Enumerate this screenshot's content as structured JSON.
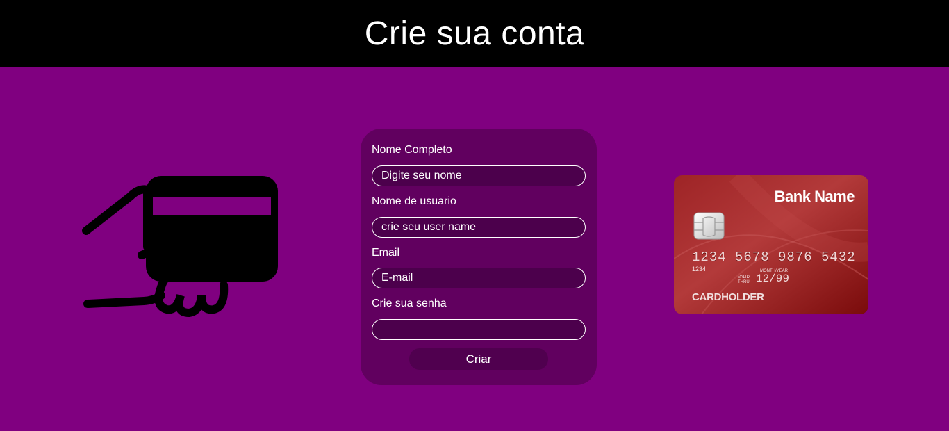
{
  "header": {
    "title": "Crie sua conta"
  },
  "form": {
    "full_name": {
      "label": "Nome Completo",
      "placeholder": "Digite seu nome"
    },
    "username": {
      "label": "Nome de usuario",
      "placeholder": "crie seu user name"
    },
    "email": {
      "label": "Email",
      "placeholder": "E-mail"
    },
    "password": {
      "label": "Crie sua senha",
      "placeholder": ""
    },
    "submit_label": "Criar"
  },
  "card_image": {
    "bank_name": "Bank Name",
    "number": "1234 5678 9876 5432",
    "number_small": "1234",
    "valid_thru": "VALID THRU",
    "month_year": "MONTH/YEAR",
    "expiry": "12/99",
    "holder": "CARDHOLDER"
  },
  "icons": {
    "left": "hand-holding-card-icon",
    "chip": "chip-icon"
  },
  "colors": {
    "background": "#800080",
    "header": "#000000",
    "form": "#61005f",
    "input": "#4c004c",
    "card": "#b03232"
  }
}
